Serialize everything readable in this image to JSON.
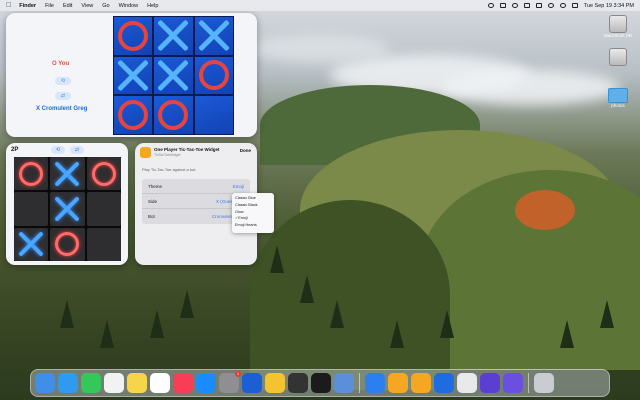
{
  "menubar": {
    "app_name": "Finder",
    "items": [
      "File",
      "Edit",
      "View",
      "Go",
      "Window",
      "Help"
    ],
    "datetime": "Tue Sep 19  3:34 PM"
  },
  "desktop_icons": [
    {
      "label": "Macintosh HD",
      "icon": "drive-icon"
    },
    {
      "label": "",
      "icon": "drive-icon"
    },
    {
      "label": "photos",
      "icon": "folder-icon"
    }
  ],
  "large_widget": {
    "player_you": "O You",
    "player_opponent": "X Cromulent Greg",
    "button1": "⟲",
    "button2": "⇄",
    "board": [
      "O",
      "X",
      "X",
      "X",
      "X",
      "O",
      "O",
      "O",
      ""
    ]
  },
  "small_widget": {
    "title": "2P",
    "button1": "⟲",
    "button2": "⇄",
    "board": [
      "O",
      "X",
      "O",
      "",
      "X",
      "",
      "X",
      "O",
      ""
    ]
  },
  "config_widget": {
    "title": "One Player Tic-Tac-Toe Widget",
    "subtitle": "TicTacToeWidget",
    "done_label": "Done",
    "description": "Play Tic-Tac-Toe against a bot.",
    "rows": [
      {
        "label": "Theme",
        "value": "Emoji"
      },
      {
        "label": "Side",
        "value": "X (Goes First)"
      },
      {
        "label": "Bot",
        "value": "Cromulent Greg"
      }
    ],
    "dropdown_options": [
      "Classic Blue",
      "Classic Black",
      "Glow",
      "Emoji",
      "Emoji Hearts"
    ],
    "dropdown_selected": "Emoji"
  },
  "dock": {
    "apps": [
      {
        "name": "finder-icon",
        "color": "#3f8fe8"
      },
      {
        "name": "safari-icon",
        "color": "#2f9bf0"
      },
      {
        "name": "messages-icon",
        "color": "#35c759"
      },
      {
        "name": "reminders-icon",
        "color": "#f2f2f2"
      },
      {
        "name": "notes-icon",
        "color": "#f7d54a"
      },
      {
        "name": "photos-icon",
        "color": "#ffffff"
      },
      {
        "name": "music-icon",
        "color": "#fa3d56"
      },
      {
        "name": "app-store-icon",
        "color": "#1a8cff"
      },
      {
        "name": "system-settings-icon",
        "color": "#8e8e93",
        "badge": "1"
      },
      {
        "name": "1password-icon",
        "color": "#1c5fd4"
      },
      {
        "name": "chrome-icon",
        "color": "#f4c430"
      },
      {
        "name": "calculator-icon",
        "color": "#333333"
      },
      {
        "name": "terminal-icon",
        "color": "#1b1b1b"
      },
      {
        "name": "preview-icon",
        "color": "#5b8fd8"
      },
      {
        "name": "xcode-icon",
        "color": "#2d7ff0"
      },
      {
        "name": "sun-app-icon",
        "color": "#f5a623"
      },
      {
        "name": "tictactoe-icon",
        "color": "#f5a623"
      },
      {
        "name": "1password-alt-icon",
        "color": "#1f6be0"
      },
      {
        "name": "text-editor-icon",
        "color": "#e9e9ec"
      },
      {
        "name": "game-purple-icon",
        "color": "#5b3fd0"
      },
      {
        "name": "game-purple-alt-icon",
        "color": "#6a4fe0"
      },
      {
        "name": "trash-icon",
        "color": "#c9ccd0"
      }
    ]
  }
}
